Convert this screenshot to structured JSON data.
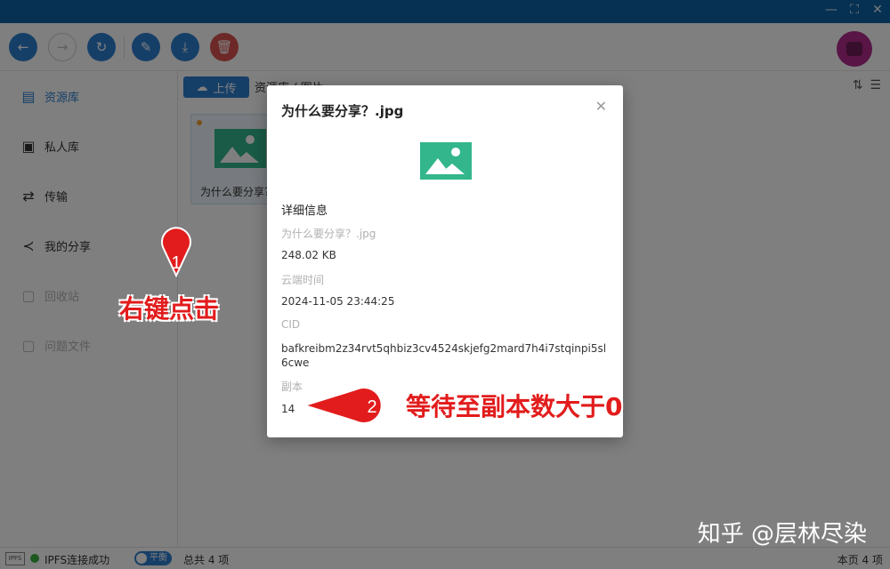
{
  "window": {
    "minimize_icon": "minimize-icon",
    "maximize_icon": "fullscreen-icon",
    "close_icon": "close-icon"
  },
  "toolbar": {
    "buttons": [
      "back-icon",
      "forward-icon",
      "refresh-icon",
      "edit-icon",
      "download-icon",
      "delete-icon"
    ],
    "accent": "#2d7fd0",
    "danger": "#d9534f"
  },
  "sidebar": {
    "items": [
      {
        "label": "资源库",
        "icon": "archive-icon"
      },
      {
        "label": "私人库",
        "icon": "private-icon"
      },
      {
        "label": "传输",
        "icon": "transfer-icon"
      },
      {
        "label": "我的分享",
        "icon": "share-icon"
      },
      {
        "label": "回收站",
        "icon": "recycle-icon"
      },
      {
        "label": "问题文件",
        "icon": "problem-file-icon"
      }
    ]
  },
  "main": {
    "upload_label": "上传",
    "breadcrumb": "资源库 / 图片",
    "file": {
      "name": "为什么要分享？.jpg"
    }
  },
  "status": {
    "ipfs_badge": "IPFS",
    "connection": "IPFS连接成功",
    "mode": "平衡",
    "total": "总共 4 项",
    "page_count": "本页 4 项"
  },
  "dialog": {
    "title": "为什么要分享？.jpg",
    "section": "详细信息",
    "filename": "为什么要分享？.jpg",
    "size": "248.02 KB",
    "cloud_time_label": "云端时间",
    "cloud_time": "2024-11-05 23:44:25",
    "cid_label": "CID",
    "cid": "bafkreibm2z34rvt5qhbiz3cv4524skjefg2mard7h4i7stqinpi5sl6cwe",
    "replica_label": "副本",
    "replica_count": "14"
  },
  "annotations": {
    "step1_number": "1",
    "step1_text": "右键点击",
    "step2_number": "2",
    "step2_text": "等待至副本数大于0"
  },
  "watermark": "知乎 @层林尽染"
}
